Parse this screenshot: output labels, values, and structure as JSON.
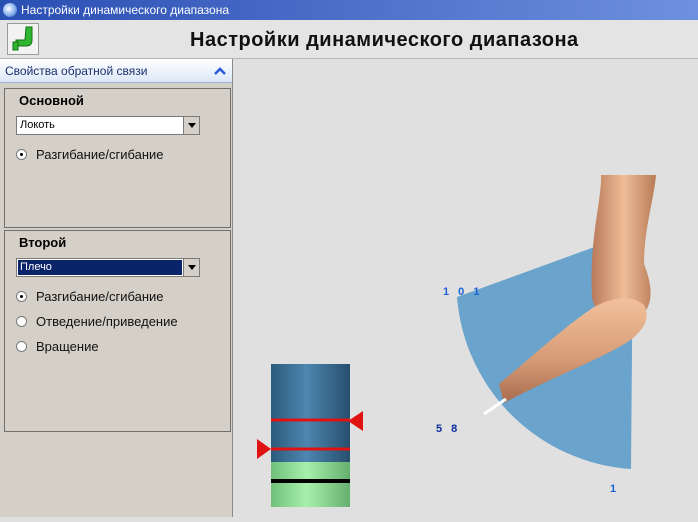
{
  "window": {
    "title": "Настройки динамического диапазона"
  },
  "header": {
    "title": "Настройки динамического диапазона",
    "logo_icon": "arm-logo-icon"
  },
  "sidebar": {
    "section_title": "Свойства обратной связи",
    "collapse_icon": "chevron-up-icon",
    "primary": {
      "title": "Основной",
      "joint_select": {
        "value": "Локоть"
      },
      "motions": [
        {
          "label": "Разгибание/сгибание",
          "checked": true
        }
      ]
    },
    "secondary": {
      "title": "Второй",
      "joint_select": {
        "value": "Плечо"
      },
      "motions": [
        {
          "label": "Разгибание/сгибание",
          "checked": true
        },
        {
          "label": "Отведение/приведение",
          "checked": false
        },
        {
          "label": "Вращение",
          "checked": false
        }
      ]
    }
  },
  "visualization": {
    "range_max": "1 0 1",
    "current_value": "5 8",
    "range_min": "1",
    "sector_color": "#6aa3cc",
    "label_color": "#1a63d4"
  }
}
